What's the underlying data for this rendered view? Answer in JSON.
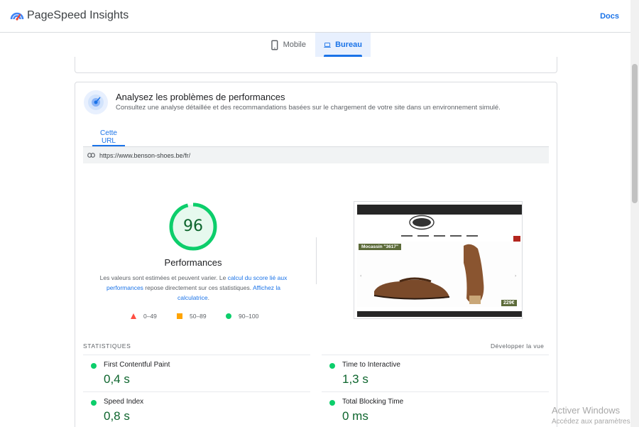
{
  "header": {
    "title": "PageSpeed Insights",
    "docs": "Docs"
  },
  "device_tabs": [
    {
      "label": "Mobile",
      "icon": "phone-icon",
      "active": false
    },
    {
      "label": "Bureau",
      "icon": "laptop-icon",
      "active": true
    }
  ],
  "diagnostics": {
    "title": "Analysez les problèmes de performances",
    "description": "Consultez une analyse détaillée et des recommandations basées sur le chargement de votre site dans un environnement simulé.",
    "tab": "Cette URL",
    "url": "https://www.benson-shoes.be/fr/"
  },
  "score": {
    "value": "96",
    "fraction": 0.96,
    "label": "Performances",
    "note_part1": "Les valeurs sont estimées et peuvent varier. Le ",
    "note_link1": "calcul du score lié aux performances",
    "note_part2": " repose directement sur ces statistiques. ",
    "note_link2": "Affichez la calculatrice",
    "note_part3": "."
  },
  "legend": [
    {
      "shape": "triangle",
      "color": "#ff4e42",
      "range": "0–49"
    },
    {
      "shape": "square",
      "color": "#ffa400",
      "range": "50–89"
    },
    {
      "shape": "circle",
      "color": "#0cce6b",
      "range": "90–100"
    }
  ],
  "thumbnail": {
    "tag": "Mocassin \"3617\"",
    "price": "229€"
  },
  "stats": {
    "title": "STATISTIQUES",
    "expand": "Développer la vue",
    "metrics": [
      {
        "name": "First Contentful Paint",
        "value": "0,4 s"
      },
      {
        "name": "Time to Interactive",
        "value": "1,3 s"
      },
      {
        "name": "Speed Index",
        "value": "0,8 s"
      },
      {
        "name": "Total Blocking Time",
        "value": "0 ms"
      }
    ]
  },
  "watermark": {
    "line1": "Activer Windows",
    "line2": "Accédez aux paramètres"
  },
  "colors": {
    "accent": "#1a73e8",
    "pass": "#0cce6b",
    "pass_text": "#0d652d"
  }
}
